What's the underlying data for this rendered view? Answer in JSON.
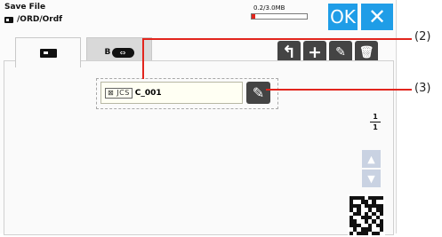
{
  "header": {
    "title": "Save File",
    "path": "/ORD/Ordf",
    "capacity": "0.2/3.0MB",
    "capacity_used_fraction": 0.07,
    "ok_label": "OK"
  },
  "icons": {
    "close": "close-icon",
    "path": "internal-memory-icon",
    "back": "folder-up-icon",
    "new_folder": "new-folder-icon",
    "rename": "pencil-icon",
    "delete": "trash-icon",
    "usb": "usb-drive-icon",
    "file_type": "embroidery-file-icon",
    "scroll_up": "scroll-up-icon",
    "scroll_down": "scroll-down-icon"
  },
  "tabs": [
    {
      "name": "machine"
    },
    {
      "name": "usb",
      "label": "B"
    }
  ],
  "files": [
    {
      "type": "JCS",
      "name": "C_001"
    }
  ],
  "pager": {
    "current": "1",
    "total": "1"
  },
  "callouts": [
    {
      "label": "(2)"
    },
    {
      "label": "(3)"
    }
  ],
  "colors": {
    "accent": "#1f9de7",
    "callout": "#e2251d",
    "toolbar": "#444444"
  }
}
